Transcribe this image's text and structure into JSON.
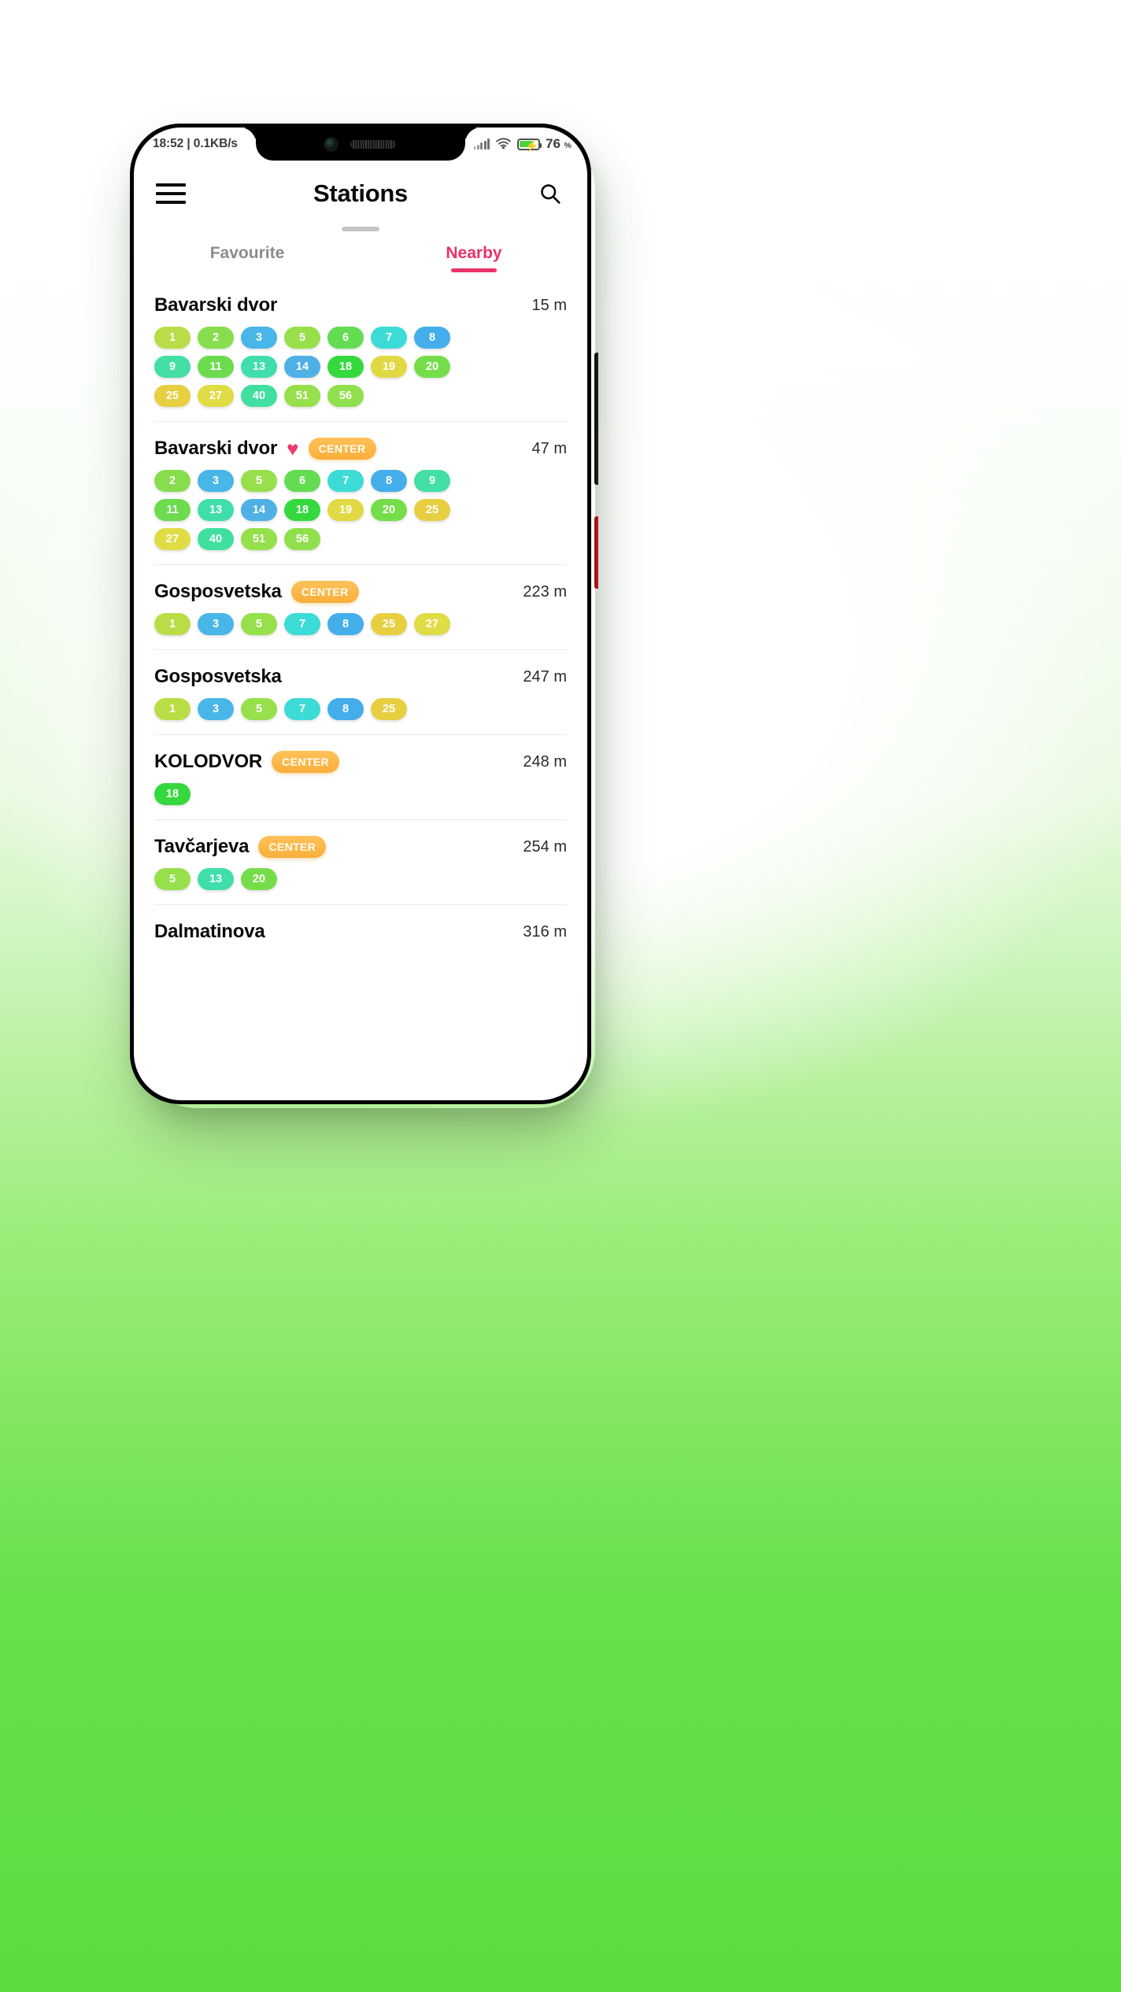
{
  "statusbar": {
    "time_and_net": "18:52 | 0.1KB/s",
    "battery_percent": "76",
    "percent_symbol": "%",
    "signal_icon": "signal-bars-icon",
    "wifi_icon": "wifi-icon",
    "battery_icon": "battery-charging-icon"
  },
  "appbar": {
    "menu_icon": "hamburger-menu-icon",
    "title": "Stations",
    "search_icon": "search-icon"
  },
  "tabs": [
    {
      "label": "Favourite",
      "active": false
    },
    {
      "label": "Nearby",
      "active": true
    }
  ],
  "colors": {
    "accent_pink": "#e8336a",
    "center_chip": "#f9ae3a",
    "heart": "#ef3b6d",
    "background_green": "#5cdc3e"
  },
  "center_label": "CENTER",
  "heart_glyph": "♥",
  "stations": [
    {
      "name": "Bavarski dvor",
      "favourite": false,
      "center": false,
      "distance": "15 m",
      "lines": [
        {
          "n": "1",
          "c": "#b9dd46"
        },
        {
          "n": "2",
          "c": "#88dd4e"
        },
        {
          "n": "3",
          "c": "#49b6e8"
        },
        {
          "n": "5",
          "c": "#97e04c"
        },
        {
          "n": "6",
          "c": "#63dc52"
        },
        {
          "n": "7",
          "c": "#3ddbd6"
        },
        {
          "n": "8",
          "c": "#44aeea"
        },
        {
          "n": "9",
          "c": "#43dfa4"
        },
        {
          "n": "11",
          "c": "#6cdc4e"
        },
        {
          "n": "13",
          "c": "#40deab"
        },
        {
          "n": "14",
          "c": "#4fb0e6"
        },
        {
          "n": "18",
          "c": "#35d93e"
        },
        {
          "n": "19",
          "c": "#e0d944"
        },
        {
          "n": "20",
          "c": "#76dd4a"
        },
        {
          "n": "25",
          "c": "#e8cf42"
        },
        {
          "n": "27",
          "c": "#dfdc45"
        },
        {
          "n": "40",
          "c": "#40dfa0"
        },
        {
          "n": "51",
          "c": "#95e04b"
        },
        {
          "n": "56",
          "c": "#8fe04c"
        }
      ]
    },
    {
      "name": "Bavarski dvor",
      "favourite": true,
      "center": true,
      "distance": "47 m",
      "lines": [
        {
          "n": "2",
          "c": "#88dd4e"
        },
        {
          "n": "3",
          "c": "#49b6e8"
        },
        {
          "n": "5",
          "c": "#97e04c"
        },
        {
          "n": "6",
          "c": "#63dc52"
        },
        {
          "n": "7",
          "c": "#3ddbd6"
        },
        {
          "n": "8",
          "c": "#44aeea"
        },
        {
          "n": "9",
          "c": "#43dfa4"
        },
        {
          "n": "11",
          "c": "#6cdc4e"
        },
        {
          "n": "13",
          "c": "#40deab"
        },
        {
          "n": "14",
          "c": "#4fb0e6"
        },
        {
          "n": "18",
          "c": "#35d93e"
        },
        {
          "n": "19",
          "c": "#e0d944"
        },
        {
          "n": "20",
          "c": "#76dd4a"
        },
        {
          "n": "25",
          "c": "#e8cf42"
        },
        {
          "n": "27",
          "c": "#dfdc45"
        },
        {
          "n": "40",
          "c": "#40dfa0"
        },
        {
          "n": "51",
          "c": "#95e04b"
        },
        {
          "n": "56",
          "c": "#8fe04c"
        }
      ]
    },
    {
      "name": "Gosposvetska",
      "favourite": false,
      "center": true,
      "distance": "223 m",
      "lines": [
        {
          "n": "1",
          "c": "#b9dd46"
        },
        {
          "n": "3",
          "c": "#49b6e8"
        },
        {
          "n": "5",
          "c": "#97e04c"
        },
        {
          "n": "7",
          "c": "#3ddbd6"
        },
        {
          "n": "8",
          "c": "#44aeea"
        },
        {
          "n": "25",
          "c": "#e8cf42"
        },
        {
          "n": "27",
          "c": "#dfdc45"
        }
      ]
    },
    {
      "name": "Gosposvetska",
      "favourite": false,
      "center": false,
      "distance": "247 m",
      "lines": [
        {
          "n": "1",
          "c": "#b9dd46"
        },
        {
          "n": "3",
          "c": "#49b6e8"
        },
        {
          "n": "5",
          "c": "#97e04c"
        },
        {
          "n": "7",
          "c": "#3ddbd6"
        },
        {
          "n": "8",
          "c": "#44aeea"
        },
        {
          "n": "25",
          "c": "#e8cf42"
        }
      ]
    },
    {
      "name": "KOLODVOR",
      "favourite": false,
      "center": true,
      "distance": "248 m",
      "lines": [
        {
          "n": "18",
          "c": "#35d93e"
        }
      ]
    },
    {
      "name": "Tavčarjeva",
      "favourite": false,
      "center": true,
      "distance": "254 m",
      "lines": [
        {
          "n": "5",
          "c": "#97e04c"
        },
        {
          "n": "13",
          "c": "#40deab"
        },
        {
          "n": "20",
          "c": "#76dd4a"
        }
      ]
    },
    {
      "name": "Dalmatinova",
      "favourite": false,
      "center": false,
      "distance": "316 m",
      "lines": []
    }
  ]
}
